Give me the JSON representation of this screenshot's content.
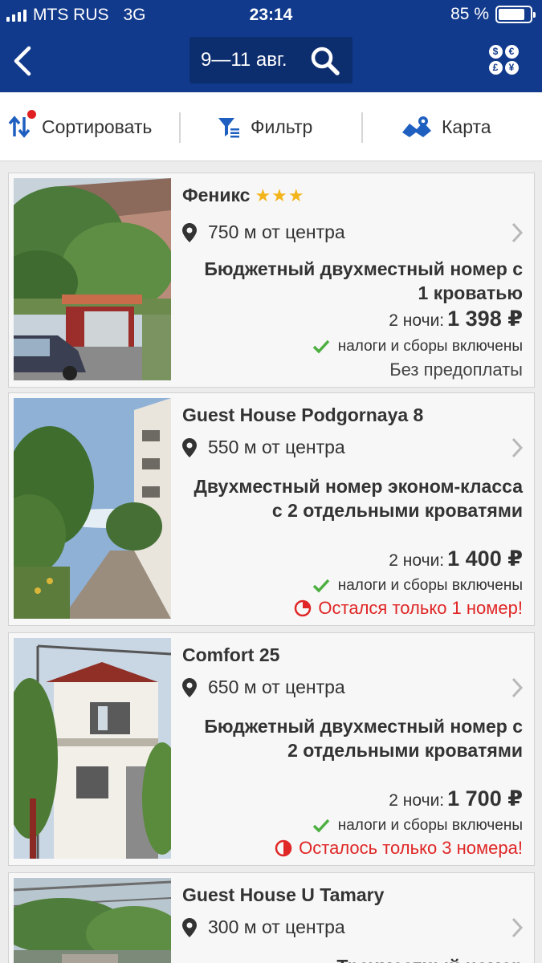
{
  "status_bar": {
    "carrier": "MTS RUS",
    "network": "3G",
    "time": "23:14",
    "battery": "85 %",
    "battery_level": 0.85
  },
  "nav": {
    "dates": "9—11 авг.",
    "back_icon": "chevron-left-icon",
    "search_icon": "search-icon",
    "currency_icon": "currency-icon",
    "currency_symbols": [
      "$",
      "€",
      "£",
      "¥"
    ]
  },
  "toolbar": {
    "sort_label": "Сортировать",
    "filter_label": "Фильтр",
    "map_label": "Карта"
  },
  "hotels": [
    {
      "name": "Феникс",
      "stars": "★★★",
      "star_count": 3,
      "distance": "750 м от центра",
      "room": "Бюджетный двухместный номер с 1 кроватью",
      "nights": "2 ночи:",
      "price": "1 398 ₽",
      "taxes": "налоги и сборы включены",
      "extra": "Без предоплаты"
    },
    {
      "name": "Guest House Podgornaya 8",
      "distance": "550 м от центра",
      "room": "Двухместный номер эконом-класса с 2 отдельными кроватями",
      "nights": "2 ночи:",
      "price": "1 400 ₽",
      "taxes": "налоги и сборы включены",
      "extra": "Остался только 1 номер!"
    },
    {
      "name": "Comfort 25",
      "distance": "650 м от центра",
      "room": "Бюджетный двухместный номер с 2 отдельными кроватями",
      "nights": "2 ночи:",
      "price": "1 700 ₽",
      "taxes": "налоги и сборы включены",
      "extra": "Осталось только 3 номера!"
    },
    {
      "name": "Guest House U Tamary",
      "distance": "300 м от центра",
      "room": "Трехместный номер"
    }
  ],
  "colors": {
    "header": "#123a8c",
    "datebox": "#0c2d6e",
    "star": "#f3b51b",
    "check": "#4caf3f",
    "alert": "#e02626"
  }
}
